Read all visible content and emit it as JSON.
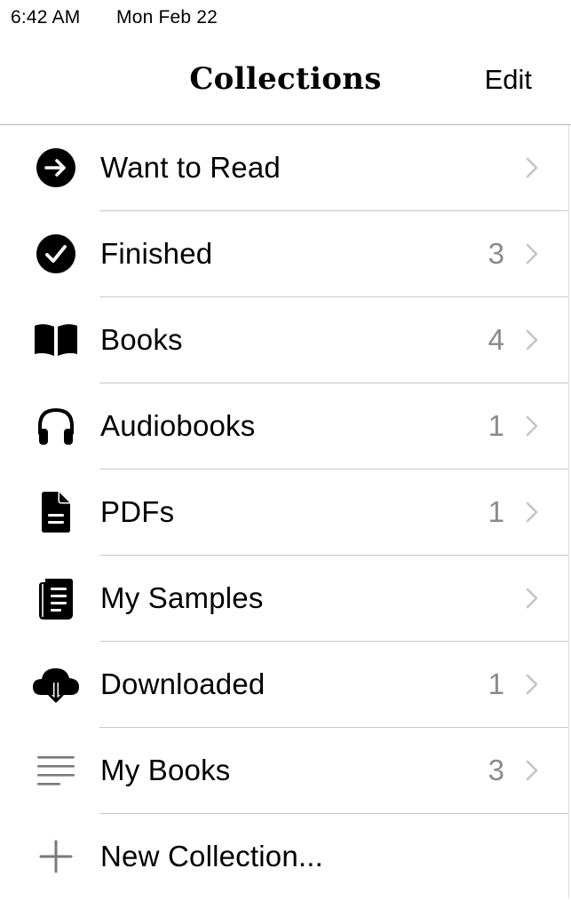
{
  "status_bar": {
    "time": "6:42 AM",
    "date": "Mon Feb 22"
  },
  "nav": {
    "title": "Collections",
    "edit_label": "Edit"
  },
  "collections": [
    {
      "label": "Want to Read",
      "count": "",
      "icon": "arrow-right-circle-icon"
    },
    {
      "label": "Finished",
      "count": "3",
      "icon": "checkmark-circle-icon"
    },
    {
      "label": "Books",
      "count": "4",
      "icon": "open-book-icon"
    },
    {
      "label": "Audiobooks",
      "count": "1",
      "icon": "headphones-icon"
    },
    {
      "label": "PDFs",
      "count": "1",
      "icon": "document-icon"
    },
    {
      "label": "My Samples",
      "count": "",
      "icon": "sample-pages-icon"
    },
    {
      "label": "Downloaded",
      "count": "1",
      "icon": "cloud-download-icon"
    },
    {
      "label": "My Books",
      "count": "3",
      "icon": "list-lines-icon"
    }
  ],
  "new_collection": {
    "label": "New Collection...",
    "icon": "plus-icon"
  },
  "colors": {
    "count_gray": "#8a8a8e",
    "chevron_gray": "#c4c4c6",
    "divider": "#c8c8cc"
  }
}
